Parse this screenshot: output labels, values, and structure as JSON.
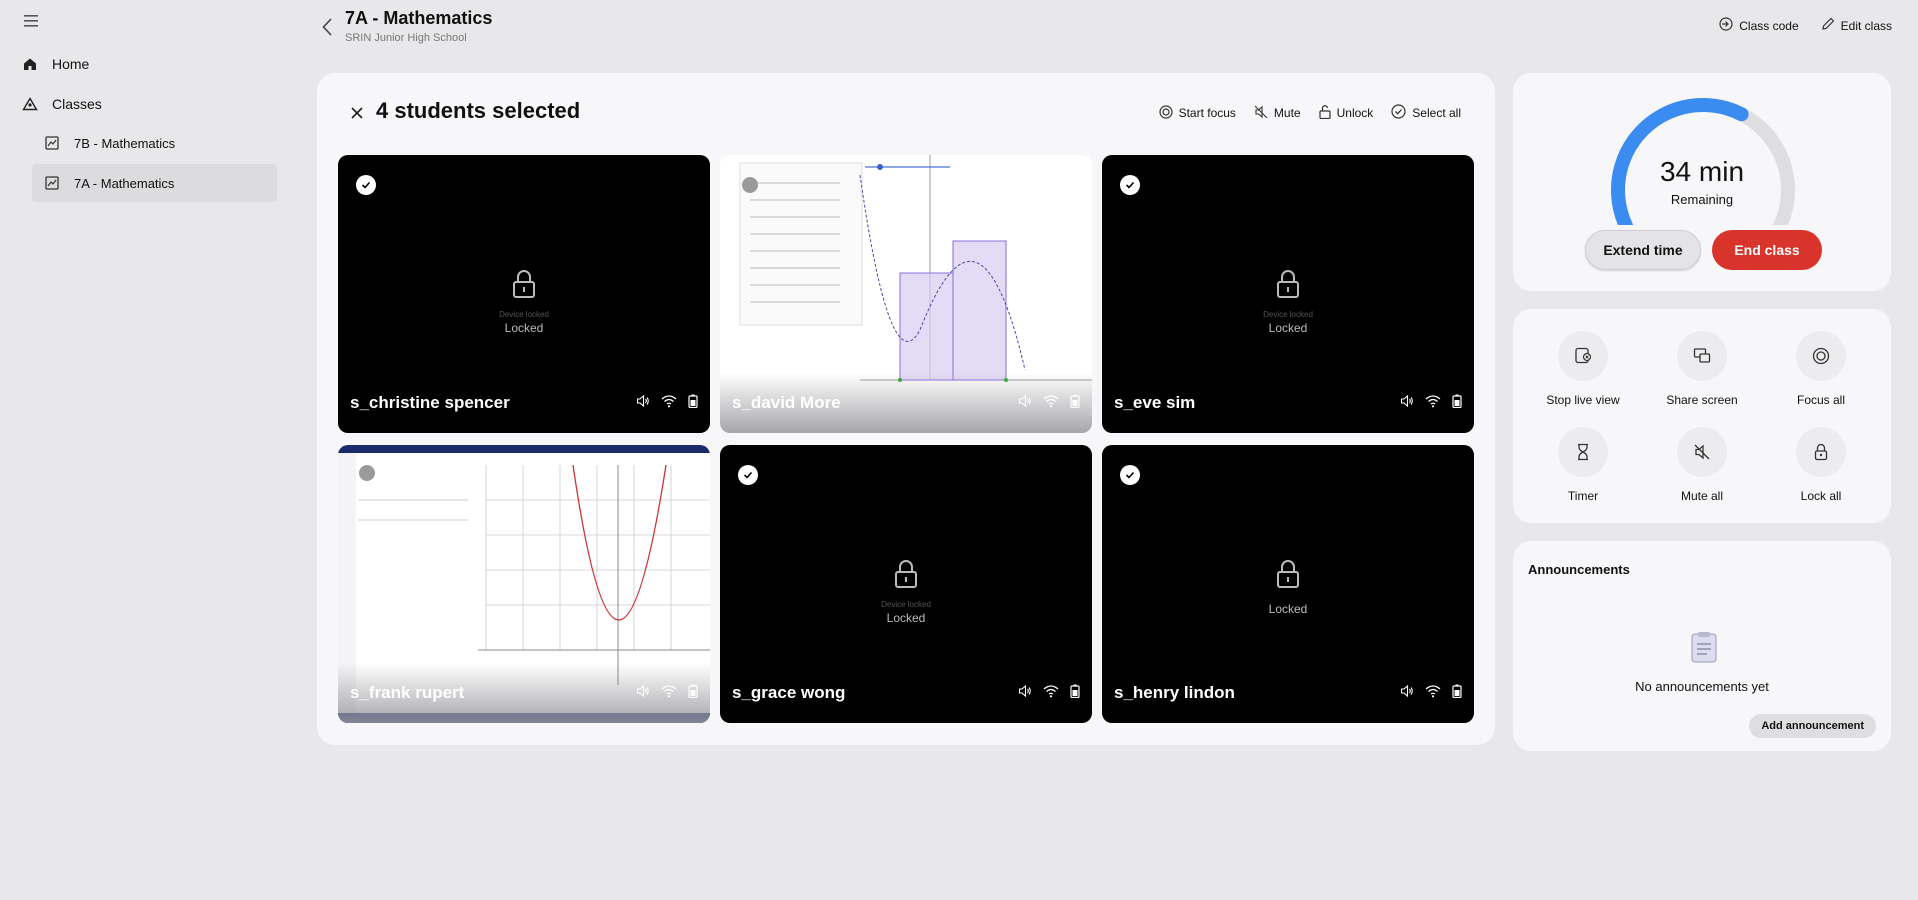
{
  "sidebar": {
    "items": [
      {
        "label": "Home",
        "icon": "home-icon"
      },
      {
        "label": "Classes",
        "icon": "classes-icon"
      },
      {
        "label": "7B - Mathematics",
        "icon": "class-icon"
      },
      {
        "label": "7A - Mathematics",
        "icon": "class-icon",
        "active": true
      }
    ]
  },
  "header": {
    "title": "7A - Mathematics",
    "subtitle": "SRIN Junior High School",
    "class_code": "Class code",
    "edit_class": "Edit class"
  },
  "selection": {
    "title": "4 students selected",
    "start_focus": "Start focus",
    "mute": "Mute",
    "unlock": "Unlock",
    "select_all": "Select all"
  },
  "students": [
    {
      "name": "s_christine spencer",
      "selected": true,
      "state": "locked",
      "lock_note": "Device locked",
      "lock_label": "Locked"
    },
    {
      "name": "s_david More",
      "selected": false,
      "state": "screen"
    },
    {
      "name": "s_eve sim",
      "selected": true,
      "state": "locked",
      "lock_note": "Device locked",
      "lock_label": "Locked"
    },
    {
      "name": "s_frank rupert",
      "selected": false,
      "state": "screen"
    },
    {
      "name": "s_grace wong",
      "selected": true,
      "state": "locked",
      "lock_note": "Device locked",
      "lock_label": "Locked"
    },
    {
      "name": "s_henry lindon",
      "selected": true,
      "state": "locked",
      "lock_note": "",
      "lock_label": "Locked"
    }
  ],
  "timer": {
    "value": "34 min",
    "sub": "Remaining",
    "remaining_fraction": 0.6,
    "extend": "Extend time",
    "end": "End class"
  },
  "actions": {
    "stop_live_view": "Stop live view",
    "share_screen": "Share screen",
    "focus_all": "Focus all",
    "timer": "Timer",
    "mute_all": "Mute all",
    "lock_all": "Lock all"
  },
  "announcements": {
    "title": "Announcements",
    "empty": "No announcements yet",
    "add": "Add announcement"
  },
  "colors": {
    "accent_blue": "#3b8cf0",
    "end_red": "#d9342b",
    "background": "#e8e8ea",
    "card": "#f7f7f9"
  }
}
